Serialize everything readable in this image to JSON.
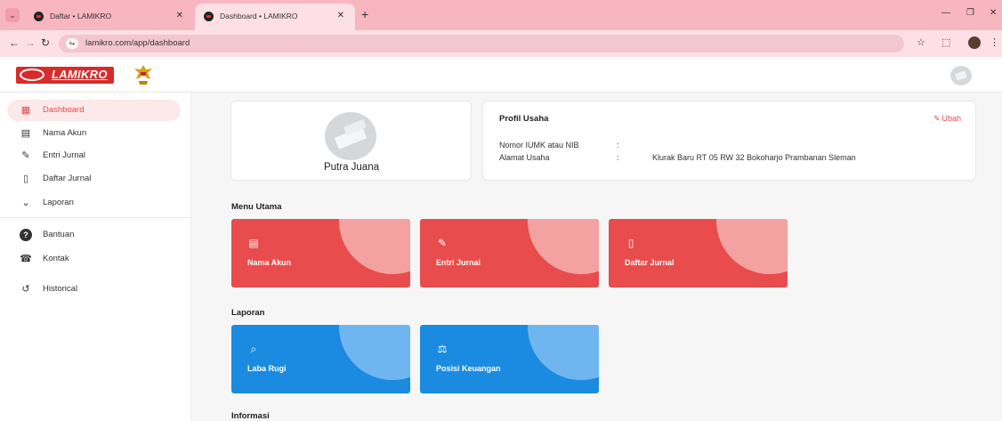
{
  "browser": {
    "tabs": [
      {
        "title": "Daftar • LAMIKRO",
        "active": false
      },
      {
        "title": "Dashboard • LAMIKRO",
        "active": true
      }
    ],
    "url": "lamikro.com/app/dashboard"
  },
  "header": {
    "logo_text": "LAMIKRO"
  },
  "sidebar": {
    "items": [
      {
        "label": "Dashboard",
        "icon": "grid-icon",
        "glyph": "▦",
        "active": true
      },
      {
        "label": "Nama Akun",
        "icon": "list-icon",
        "glyph": "▤"
      },
      {
        "label": "Entri Jurnal",
        "icon": "pencil-icon",
        "glyph": "✎"
      },
      {
        "label": "Daftar Jurnal",
        "icon": "notebook-icon",
        "glyph": "▯"
      },
      {
        "label": "Laporan",
        "icon": "chevron-down-icon",
        "glyph": "⌄"
      },
      {
        "label": "Bantuan",
        "icon": "help-icon",
        "glyph": "?"
      },
      {
        "label": "Kontak",
        "icon": "phone-icon",
        "glyph": "☎"
      },
      {
        "label": "Historical",
        "icon": "history-icon",
        "glyph": "↺"
      }
    ]
  },
  "profile": {
    "name": "Putra Juana",
    "title": "Profil Usaha",
    "edit_label": "Ubah",
    "fields": [
      {
        "label": "Nomor IUMK atau NIB",
        "colon": ":",
        "value": ""
      },
      {
        "label": "Alamat Usaha",
        "colon": ":",
        "value": "Klurak Baru RT 05 RW 32 Bokoharjo Prambanan Sleman"
      }
    ]
  },
  "sections": {
    "menu_utama": "Menu Utama",
    "laporan": "Laporan",
    "informasi": "Informasi"
  },
  "menu_tiles": [
    {
      "label": "Nama Akun",
      "icon": "list-icon",
      "glyph": "▤"
    },
    {
      "label": "Entri Jurnal",
      "icon": "pencil-icon",
      "glyph": "✎"
    },
    {
      "label": "Daftar Jurnal",
      "icon": "notebook-icon",
      "glyph": "▯"
    }
  ],
  "report_tiles": [
    {
      "label": "Laba Rugi",
      "icon": "report-search-icon",
      "glyph": "⌕"
    },
    {
      "label": "Posisi Keuangan",
      "icon": "balance-scale-icon",
      "glyph": "⚖"
    }
  ],
  "colors": {
    "accent_red": "#e84c4c",
    "accent_blue": "#1a8be0",
    "browser_pink": "#f8b6c1"
  }
}
